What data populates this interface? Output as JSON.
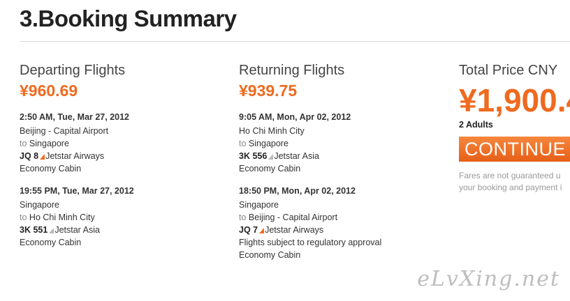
{
  "page_title": "3.Booking Summary",
  "departing": {
    "heading": "Departing Flights",
    "price": "¥960.69",
    "segments": [
      {
        "datetime": "2:50 AM, Tue, Mar 27, 2012",
        "from": "Beijing - Capital Airport",
        "to_label": "to",
        "to": "Singapore",
        "flight_no": "JQ 8",
        "airline": "Jetstar Airways",
        "cabin": "Economy Cabin"
      },
      {
        "datetime": "19:55 PM, Tue, Mar 27, 2012",
        "from": "Singapore",
        "to_label": "to",
        "to": "Ho Chi Minh City",
        "flight_no": "3K 551",
        "airline": "Jetstar Asia",
        "cabin": "Economy Cabin"
      }
    ]
  },
  "returning": {
    "heading": "Returning Flights",
    "price": "¥939.75",
    "segments": [
      {
        "datetime": "9:05 AM, Mon, Apr 02, 2012",
        "from": "Ho Chi Minh City",
        "to_label": "to",
        "to": "Singapore",
        "flight_no": "3K 556",
        "airline": "Jetstar Asia",
        "cabin": "Economy Cabin"
      },
      {
        "datetime": "18:50 PM, Mon, Apr 02, 2012",
        "from": "Singapore",
        "to_label": "to",
        "to": "Beijing - Capital Airport",
        "flight_no": "JQ 7",
        "airline": "Jetstar Airways",
        "note": "Flights subject to regulatory approval",
        "cabin": "Economy Cabin"
      }
    ]
  },
  "total": {
    "heading": "Total Price CNY",
    "price": "¥1,900.4",
    "passengers": "2 Adults",
    "continue_label": "CONTINUE",
    "fares_line1": "Fares are not guaranteed u",
    "fares_line2": "your booking and payment i"
  },
  "watermark": "eLvXing.net",
  "colors": {
    "accent": "#ef6a1f",
    "jetstar_airways_tail": "#ef6a1f",
    "jetstar_asia_tail": "#b8b8b8"
  }
}
